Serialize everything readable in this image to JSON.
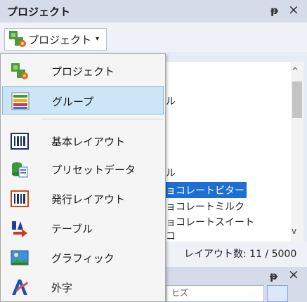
{
  "panel": {
    "title": "プロジェクト",
    "pin_glyph": "ᵽ",
    "close_glyph": "×"
  },
  "toolbar": {
    "project_button_label": "プロジェクト",
    "caret": "▾"
  },
  "menu": {
    "items": [
      {
        "label": "プロジェクト",
        "icon": "project-icon"
      },
      {
        "label": "グループ",
        "icon": "group-icon",
        "highlighted": true
      },
      {
        "label": "基本レイアウト",
        "icon": "layout-icon"
      },
      {
        "label": "プリセットデータ",
        "icon": "preset-data-icon"
      },
      {
        "label": "発行レイアウト",
        "icon": "publish-layout-icon"
      },
      {
        "label": "テーブル",
        "icon": "table-icon"
      },
      {
        "label": "グラフィック",
        "icon": "graphic-icon"
      },
      {
        "label": "外字",
        "icon": "gaiji-icon"
      }
    ]
  },
  "tree": {
    "lines": [
      {
        "text": "ル"
      },
      {
        "text": "ル"
      },
      {
        "text": "ョコレートビター",
        "selected": true
      },
      {
        "text": "ョコレートミルク"
      },
      {
        "text": "ョコレートスイート"
      },
      {
        "text": "コ"
      }
    ],
    "scroll_up": "^",
    "scroll_down": "v"
  },
  "status": {
    "layout_count": "レイアウト数: 11 / 5000"
  },
  "lower_panel": {
    "pin_glyph": "ᵽ",
    "close_glyph": "×",
    "field_text": "ヒズ"
  },
  "colors": {
    "selection": "#1e6fd2",
    "highlight": "#cde6f7",
    "titlebar": "#d6dbe9"
  }
}
